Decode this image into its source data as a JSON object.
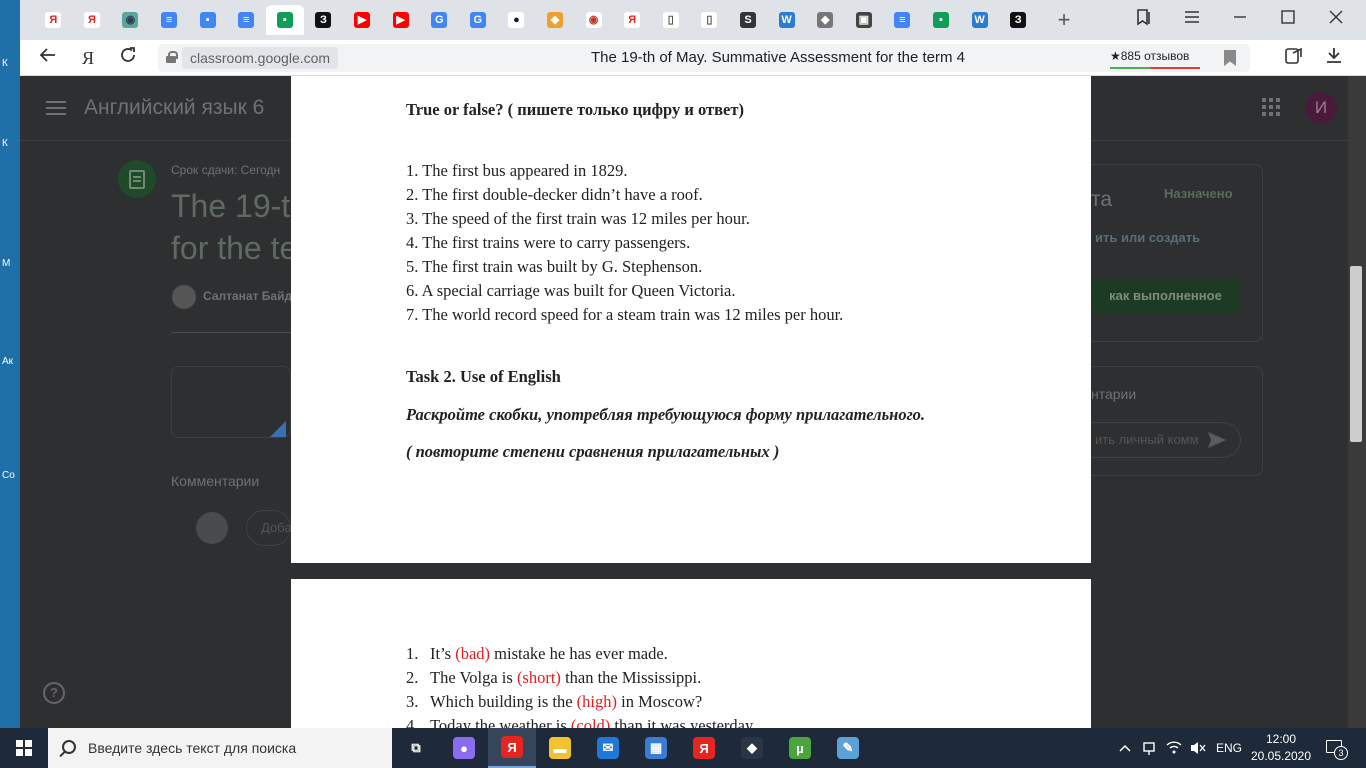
{
  "browser": {
    "url_domain": "classroom.google.com",
    "page_title": "The 19-th of May. Summative Assessment for the term 4",
    "reviews": "★885 отзывов",
    "new_tab_label": "+"
  },
  "tabs": [
    {
      "icon": "yandex-icon",
      "glyph": "Я",
      "bg": "#ffffff",
      "fg": "#e52620"
    },
    {
      "icon": "yandex-icon",
      "glyph": "Я",
      "bg": "#ffffff",
      "fg": "#e52620"
    },
    {
      "icon": "gamepad-icon",
      "glyph": "◉",
      "bg": "#5aa5a0",
      "fg": "#2c3e50"
    },
    {
      "icon": "google-docs-icon",
      "glyph": "≡",
      "bg": "#4285f4",
      "fg": "#ffffff"
    },
    {
      "icon": "google-classroom-icon",
      "glyph": "▪",
      "bg": "#4285f4",
      "fg": "#ffffff"
    },
    {
      "icon": "google-docs-icon",
      "glyph": "≡",
      "bg": "#4285f4",
      "fg": "#ffffff"
    },
    {
      "icon": "google-classroom-icon",
      "glyph": "▪",
      "bg": "#0f9d58",
      "fg": "#ffffff",
      "active": true
    },
    {
      "icon": "znanija-icon",
      "glyph": "З",
      "bg": "#111111",
      "fg": "#ffffff"
    },
    {
      "icon": "youtube-icon",
      "glyph": "▶",
      "bg": "#ff0000",
      "fg": "#ffffff"
    },
    {
      "icon": "youtube-icon",
      "glyph": "▶",
      "bg": "#ff0000",
      "fg": "#ffffff"
    },
    {
      "icon": "google-translate-icon",
      "glyph": "G",
      "bg": "#4285f4",
      "fg": "#ffffff"
    },
    {
      "icon": "google-translate-icon",
      "glyph": "G",
      "bg": "#4285f4",
      "fg": "#ffffff"
    },
    {
      "icon": "dark-circle-icon",
      "glyph": "●",
      "bg": "#ffffff",
      "fg": "#111a44"
    },
    {
      "icon": "puzzle-icon",
      "glyph": "◆",
      "bg": "#f0a030",
      "fg": "#ffffff"
    },
    {
      "icon": "shield-icon",
      "glyph": "◉",
      "bg": "#ffffff",
      "fg": "#c0392b"
    },
    {
      "icon": "yandex-icon",
      "glyph": "Я",
      "bg": "#ffffff",
      "fg": "#e52620"
    },
    {
      "icon": "file-icon",
      "glyph": "▯",
      "bg": "#ffffff",
      "fg": "#555555"
    },
    {
      "icon": "file-icon",
      "glyph": "▯",
      "bg": "#ffffff",
      "fg": "#555555"
    },
    {
      "icon": "s-letter-icon",
      "glyph": "S",
      "bg": "#333333",
      "fg": "#ffffff"
    },
    {
      "icon": "word-doc-icon",
      "glyph": "W",
      "bg": "#2b7cd3",
      "fg": "#ffffff"
    },
    {
      "icon": "grey-app-icon",
      "glyph": "◆",
      "bg": "#777777",
      "fg": "#ffffff"
    },
    {
      "icon": "id-card-icon",
      "glyph": "▣",
      "bg": "#444444",
      "fg": "#ffffff"
    },
    {
      "icon": "google-docs-icon",
      "glyph": "≡",
      "bg": "#4285f4",
      "fg": "#ffffff"
    },
    {
      "icon": "google-classroom-icon",
      "glyph": "▪",
      "bg": "#0f9d58",
      "fg": "#ffffff"
    },
    {
      "icon": "word-doc-icon",
      "glyph": "W",
      "bg": "#2b7cd3",
      "fg": "#ffffff"
    },
    {
      "icon": "znanija-icon",
      "glyph": "З",
      "bg": "#111111",
      "fg": "#ffffff"
    }
  ],
  "classroom": {
    "course_title": "Английский язык 6",
    "due_prefix": "Срок сдачи: Сегодн",
    "title_line1": "The 19-t",
    "title_line2": "for the te",
    "author": "Салтанат Байд",
    "comments_label": "Комментарии",
    "comment_placeholder": "Доба",
    "assigned_status": "Назначено",
    "your_work_partial": "та",
    "add_or_create": "ить или создать",
    "mark_done": "как выполненное",
    "private_comments_partial": "нтарии",
    "private_placeholder": "ить личный комм",
    "avatar_letter": "И"
  },
  "document": {
    "page1": {
      "heading": "True or false? ( пишете только цифру и ответ)",
      "items": [
        "1. The first bus appeared in 1829.",
        "2. The first double-decker didn’t have a roof.",
        "3. The speed of the first train was 12 miles per hour.",
        "4. The first trains were to carry passengers.",
        "5. The first train was built by G. Stephenson.",
        "6. A special carriage was built for Queen Victoria.",
        "7. The world record speed for a steam train was 12 miles per hour."
      ],
      "task_title": "Task 2. Use of English",
      "instruction": "Раскройте скобки, употребляя требующуюся форму прилагательного.",
      "hint": "( повторите степени сравнения прилагательных )"
    },
    "page2": {
      "items": [
        {
          "num": "1.",
          "before": "It’s  ",
          "word": "(bad)",
          "after": " mistake he has ever made."
        },
        {
          "num": "2.",
          "before": "The Volga is ",
          "word": "(short)",
          "after": " than the Mississippi."
        },
        {
          "num": "3.",
          "before": "Which building is the ",
          "word": "(high)",
          "after": " in Moscow?"
        },
        {
          "num": "4.",
          "before": "Today the weather is ",
          "word": "(cold)",
          "after": " than it was yesterday."
        }
      ]
    }
  },
  "taskbar": {
    "search_placeholder": "Введите здесь текст для поиска",
    "language": "ENG",
    "time": "12:00",
    "date": "20.05.2020",
    "notification_count": "3",
    "apps": [
      {
        "icon": "task-view-icon",
        "glyph": "⧉",
        "bg": "transparent"
      },
      {
        "icon": "alice-icon",
        "glyph": "●",
        "bg": "#8a6cf0"
      },
      {
        "icon": "yandex-browser-icon",
        "glyph": "Я",
        "bg": "#e52620",
        "active": true
      },
      {
        "icon": "file-explorer-icon",
        "glyph": "▬",
        "bg": "#f2c230"
      },
      {
        "icon": "mail-icon",
        "glyph": "✉",
        "bg": "#1e78d7"
      },
      {
        "icon": "store-icon",
        "glyph": "▦",
        "bg": "#3a7bd5"
      },
      {
        "icon": "yandex-icon",
        "glyph": "Я",
        "bg": "#e52620"
      },
      {
        "icon": "app-icon",
        "glyph": "◆",
        "bg": "#2a3546"
      },
      {
        "icon": "utorrent-icon",
        "glyph": "µ",
        "bg": "#4aa53d"
      },
      {
        "icon": "paint-icon",
        "glyph": "✎",
        "bg": "#5ba2d8"
      }
    ]
  },
  "desktop": {
    "glyphs": [
      "К",
      "К",
      "М",
      "Ак",
      "Со"
    ]
  }
}
